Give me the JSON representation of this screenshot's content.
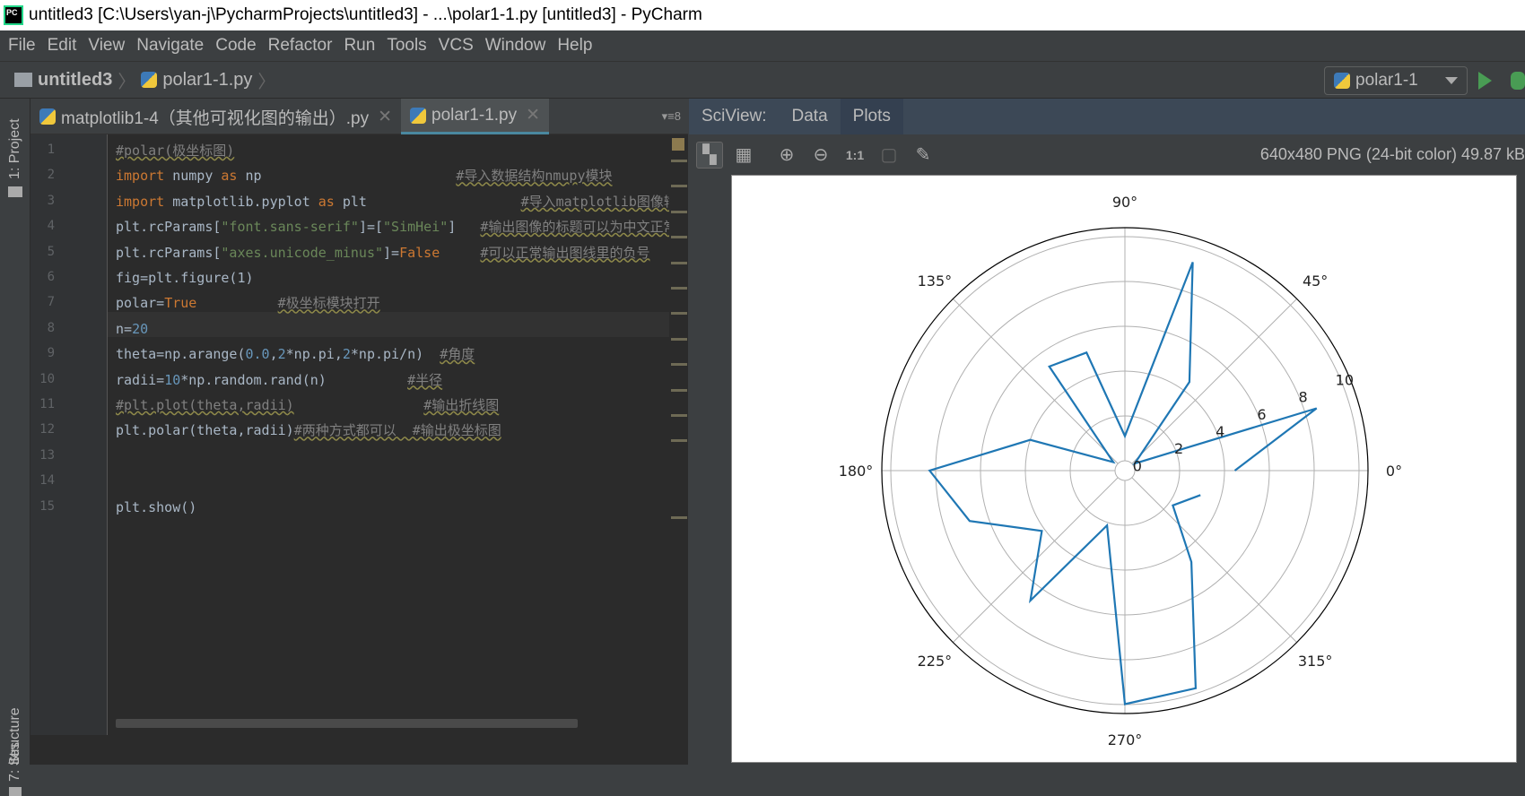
{
  "window": {
    "title": "untitled3 [C:\\Users\\yan-j\\PycharmProjects\\untitled3] - ...\\polar1-1.py [untitled3] - PyCharm",
    "logo": "PC"
  },
  "menu": [
    "File",
    "Edit",
    "View",
    "Navigate",
    "Code",
    "Refactor",
    "Run",
    "Tools",
    "VCS",
    "Window",
    "Help"
  ],
  "breadcrumb": {
    "project": "untitled3",
    "file": "polar1-1.py"
  },
  "run_config": "polar1-1",
  "left_strip": {
    "project": "1: Project",
    "structure": "7: Structure",
    "favorites": "ites"
  },
  "tabs": [
    {
      "label": "matplotlib1-4（其他可视化图的输出）.py",
      "active": false
    },
    {
      "label": "polar1-1.py",
      "active": true
    }
  ],
  "tab_overflow": "▾≡8",
  "code": [
    {
      "n": "1",
      "tokens": [
        [
          "#polar(极坐标图)",
          "cm"
        ]
      ]
    },
    {
      "n": "2",
      "tokens": [
        [
          "import",
          "kw"
        ],
        [
          " numpy ",
          ""
        ],
        [
          "as",
          "kw"
        ],
        [
          " np                        ",
          ""
        ],
        [
          "#导入数据结构nmupy模块",
          "cm"
        ]
      ]
    },
    {
      "n": "3",
      "tokens": [
        [
          "import",
          "kw"
        ],
        [
          " matplotlib.pyplot ",
          ""
        ],
        [
          "as",
          "kw"
        ],
        [
          " plt                   ",
          ""
        ],
        [
          "#导入matplotlib图像输出模块",
          "cm"
        ]
      ]
    },
    {
      "n": "4",
      "tokens": [
        [
          "plt.rcParams[",
          ""
        ],
        [
          "\"font.sans-serif\"",
          "str"
        ],
        [
          "]=[",
          ""
        ],
        [
          "\"SimHei\"",
          "str"
        ],
        [
          "]   ",
          ""
        ],
        [
          "#输出图像的标题可以为中文正常输出",
          "cm"
        ]
      ]
    },
    {
      "n": "5",
      "tokens": [
        [
          "plt.rcParams[",
          ""
        ],
        [
          "\"axes.unicode_minus\"",
          "str"
        ],
        [
          "]=",
          ""
        ],
        [
          "False",
          "kw"
        ],
        [
          "     ",
          ""
        ],
        [
          "#可以正常输出图线里的负号",
          "cm"
        ]
      ]
    },
    {
      "n": "6",
      "tokens": [
        [
          "fig=plt.figure(1)",
          ""
        ]
      ]
    },
    {
      "n": "7",
      "tokens": [
        [
          "polar=",
          ""
        ],
        [
          "True",
          "kw"
        ],
        [
          "          ",
          ""
        ],
        [
          "#极坐标模块打开",
          "cm"
        ]
      ]
    },
    {
      "n": "8",
      "tokens": [
        [
          "n=",
          ""
        ],
        [
          "20",
          "num"
        ]
      ]
    },
    {
      "n": "9",
      "tokens": [
        [
          "theta=np.arange(",
          ""
        ],
        [
          "0.0",
          "num"
        ],
        [
          ",",
          ""
        ],
        [
          "2",
          "num"
        ],
        [
          "*np.pi,",
          ""
        ],
        [
          "2",
          "num"
        ],
        [
          "*np.pi/n)  ",
          ""
        ],
        [
          "#角度",
          "cm"
        ]
      ]
    },
    {
      "n": "10",
      "tokens": [
        [
          "radii=",
          ""
        ],
        [
          "10",
          "num"
        ],
        [
          "*np.random.rand(n)          ",
          ""
        ],
        [
          "#半径",
          "cm"
        ]
      ]
    },
    {
      "n": "11",
      "tokens": [
        [
          "#plt.plot(theta,radii)",
          "cm"
        ],
        [
          "                ",
          ""
        ],
        [
          "#输出折线图",
          "cm"
        ]
      ]
    },
    {
      "n": "12",
      "tokens": [
        [
          "plt.polar(theta,radii)",
          ""
        ],
        [
          "#两种方式都可以  #输出极坐标图",
          "cm"
        ]
      ]
    },
    {
      "n": "13",
      "tokens": []
    },
    {
      "n": "14",
      "tokens": []
    },
    {
      "n": "15",
      "tokens": [
        [
          "plt.show()",
          ""
        ]
      ]
    }
  ],
  "sciview": {
    "label": "SciView:",
    "tabs": [
      "Data",
      "Plots"
    ],
    "active": "Plots",
    "image_info": "640x480 PNG (24-bit color) 49.87 kB",
    "toolbar_icons": [
      "chessboard-icon",
      "grid-icon",
      "zoom-in-icon",
      "zoom-out-icon",
      "actual-size-icon",
      "fit-icon",
      "color-picker-icon"
    ],
    "actual_size": "1:1"
  },
  "chart_data": {
    "type": "line",
    "projection": "polar",
    "theta_deg": [
      0,
      18,
      36,
      54,
      72,
      90,
      108,
      126,
      144,
      162,
      180,
      198,
      216,
      234,
      252,
      270,
      288,
      306,
      324,
      342
    ],
    "r": [
      4.46,
      8.55,
      0.1,
      4.45,
      9.34,
      1.1,
      5.1,
      5.3,
      0.2,
      4.0,
      8.27,
      6.84,
      4.14,
      6.73,
      2.13,
      9.98,
      9.77,
      4.6,
      2.2,
      3.1
    ],
    "rlim": [
      0,
      10.4
    ],
    "rticks": [
      "0",
      "2",
      "4",
      "6",
      "8",
      "10"
    ],
    "theta_ticks": [
      "0°",
      "45°",
      "90°",
      "135°",
      "180°",
      "225°",
      "270°",
      "315°"
    ],
    "line_color": "#1f77b4",
    "grid": true,
    "title": ""
  }
}
